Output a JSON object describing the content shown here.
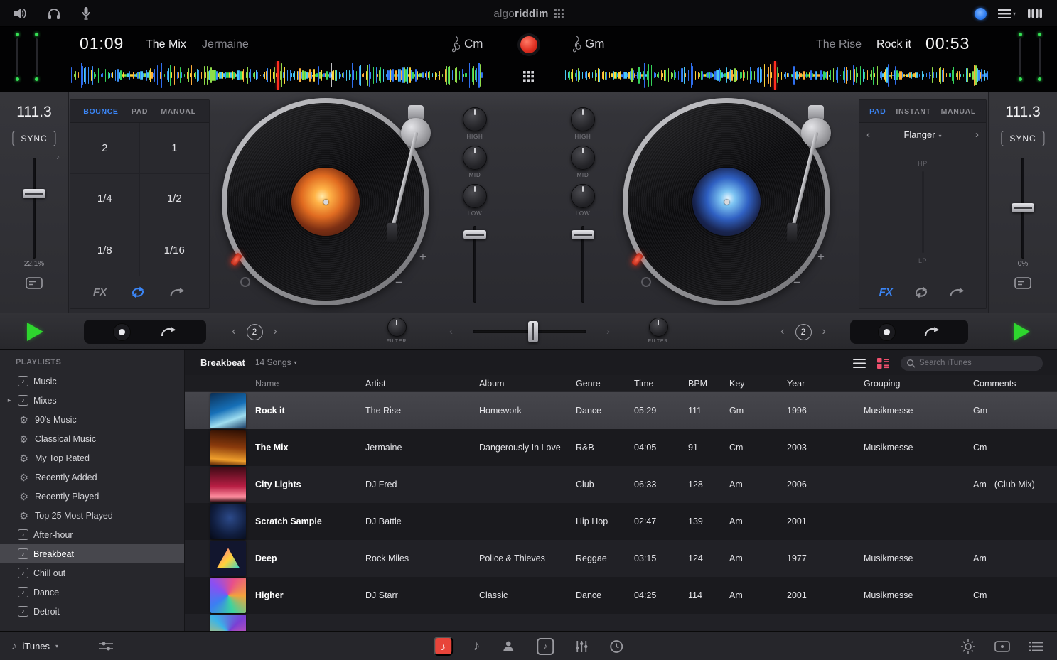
{
  "topbar": {
    "logo_light": "algo",
    "logo_bold": "riddim"
  },
  "icons": {
    "note": "♪",
    "gear": "⚙",
    "disclosure": "▸",
    "chevron_down": "▾",
    "chevron_left": "‹",
    "chevron_right": "›",
    "plus": "+",
    "minus": "−"
  },
  "colors": {
    "accent_blue": "#3b86f7",
    "play_green": "#2ed62e",
    "record_red": "#e23325",
    "grid_pink": "#f0506e",
    "meter_green": "#35e054"
  },
  "deck_a": {
    "time": "01:09",
    "title": "The Mix",
    "artist": "Jermaine",
    "key": "Cm",
    "bpm": "111.3",
    "sync_label": "SYNC",
    "pitch_percent": "22.1%",
    "tabs": [
      "BOUNCE",
      "PAD",
      "MANUAL"
    ],
    "pads": [
      "2",
      "1",
      "1/4",
      "1/2",
      "1/8",
      "1/16"
    ],
    "fx_label": "FX"
  },
  "deck_b": {
    "time": "00:53",
    "title": "Rock it",
    "artist": "The Rise",
    "key": "Gm",
    "bpm": "111.3",
    "sync_label": "SYNC",
    "pitch_percent": "0%",
    "tabs": [
      "PAD",
      "INSTANT",
      "MANUAL"
    ],
    "effect_name": "Flanger",
    "hp_label": "HP",
    "lp_label": "LP",
    "fx_label": "FX"
  },
  "mixer": {
    "knob_labels": [
      "HIGH",
      "MID",
      "LOW"
    ],
    "filter_label": "FILTER",
    "loop_value_a": "2",
    "loop_value_b": "2"
  },
  "library": {
    "sidebar_title": "PLAYLISTS",
    "playlists": [
      {
        "label": "Music",
        "icon": "playlist"
      },
      {
        "label": "Mixes",
        "icon": "playlist",
        "expandable": true
      },
      {
        "label": "90's Music",
        "icon": "smart"
      },
      {
        "label": "Classical Music",
        "icon": "smart"
      },
      {
        "label": "My Top Rated",
        "icon": "smart"
      },
      {
        "label": "Recently Added",
        "icon": "smart"
      },
      {
        "label": "Recently Played",
        "icon": "smart"
      },
      {
        "label": "Top 25 Most Played",
        "icon": "smart"
      },
      {
        "label": "After-hour",
        "icon": "playlist"
      },
      {
        "label": "Breakbeat",
        "icon": "playlist",
        "selected": true
      },
      {
        "label": "Chill out",
        "icon": "playlist"
      },
      {
        "label": "Dance",
        "icon": "playlist"
      },
      {
        "label": "Detroit",
        "icon": "playlist"
      }
    ],
    "header_title": "Breakbeat",
    "header_count": "14 Songs",
    "search_placeholder": "Search iTunes",
    "columns": [
      "Name",
      "Artist",
      "Album",
      "Genre",
      "Time",
      "BPM",
      "Key",
      "Year",
      "Grouping",
      "Comments"
    ],
    "songs": [
      {
        "name": "Rock it",
        "artist": "The Rise",
        "album": "Homework",
        "genre": "Dance",
        "time": "05:29",
        "bpm": "111",
        "key": "Gm",
        "year": "1996",
        "grouping": "Musikmesse",
        "comments": "Gm",
        "art": "art-rockit",
        "selected": true
      },
      {
        "name": "The Mix",
        "artist": "Jermaine",
        "album": "Dangerously In Love",
        "genre": "R&B",
        "time": "04:05",
        "bpm": "91",
        "key": "Cm",
        "year": "2003",
        "grouping": "Musikmesse",
        "comments": "Cm",
        "art": "art-themix"
      },
      {
        "name": "City Lights",
        "artist": "DJ Fred",
        "album": "",
        "genre": "Club",
        "time": "06:33",
        "bpm": "128",
        "key": "Am",
        "year": "2006",
        "grouping": "",
        "comments": "Am - (Club Mix)",
        "art": "art-citylights"
      },
      {
        "name": "Scratch Sample",
        "artist": "DJ Battle",
        "album": "",
        "genre": "Hip Hop",
        "time": "02:47",
        "bpm": "139",
        "key": "Am",
        "year": "2001",
        "grouping": "",
        "comments": "",
        "art": "art-scratch"
      },
      {
        "name": "Deep",
        "artist": "Rock Miles",
        "album": "Police & Thieves",
        "genre": "Reggae",
        "time": "03:15",
        "bpm": "124",
        "key": "Am",
        "year": "1977",
        "grouping": "Musikmesse",
        "comments": "Am",
        "art": "art-deep"
      },
      {
        "name": "Higher",
        "artist": "DJ Starr",
        "album": "Classic",
        "genre": "Dance",
        "time": "04:25",
        "bpm": "114",
        "key": "Am",
        "year": "2001",
        "grouping": "Musikmesse",
        "comments": "Cm",
        "art": "art-higher"
      }
    ]
  },
  "bottombar": {
    "source_label": "iTunes"
  }
}
